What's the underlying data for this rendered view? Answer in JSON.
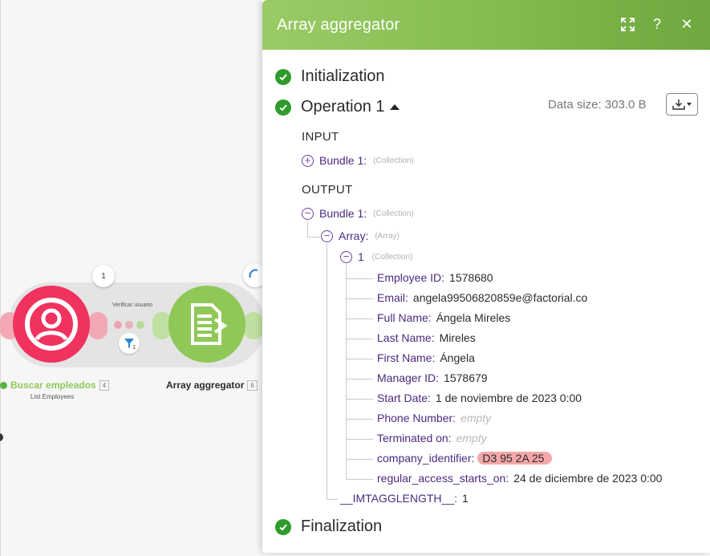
{
  "canvas": {
    "module1": {
      "name": "Buscar empleados",
      "index": "4",
      "subtitle": "List Employees"
    },
    "module2": {
      "name": "Array aggregator",
      "index": "6"
    },
    "filter": {
      "label": "Verificar usuario",
      "count": "1"
    },
    "bubble_count": "1"
  },
  "panel": {
    "title": "Array aggregator",
    "initialization": "Initialization",
    "operation": "Operation 1",
    "finalization": "Finalization",
    "data_size": "Data size: 303.0 B",
    "input_heading": "INPUT",
    "output_heading": "OUTPUT",
    "input_bundle": {
      "key": "Bundle 1:",
      "type": "(Collection)"
    },
    "output_bundle": {
      "key": "Bundle 1:",
      "type": "(Collection)"
    },
    "array": {
      "key": "Array:",
      "type": "(Array)"
    },
    "item": {
      "key": "1",
      "type": "(Collection)"
    },
    "fields": [
      {
        "key": "Employee ID:",
        "value": "1578680"
      },
      {
        "key": "Email:",
        "value": "angela99506820859e@factorial.co"
      },
      {
        "key": "Full Name:",
        "value": "Ángela Mireles"
      },
      {
        "key": "Last Name:",
        "value": "Mireles"
      },
      {
        "key": "First Name:",
        "value": "Ángela"
      },
      {
        "key": "Manager ID:",
        "value": "1578679"
      },
      {
        "key": "Start Date:",
        "value": "1 de noviembre de 2023 0:00"
      },
      {
        "key": "Phone Number:",
        "value": "empty"
      },
      {
        "key": "Terminated on:",
        "value": "empty"
      },
      {
        "key": "company_identifier:",
        "value": "D3 95 2A 25"
      },
      {
        "key": "regular_access_starts_on:",
        "value": "24 de diciembre de 2023 0:00"
      }
    ],
    "length": {
      "key": "__IMTAGGLENGTH__:",
      "value": "1"
    }
  },
  "colors": {
    "header_green": "#8fc857",
    "check_green": "#2f9b2c",
    "key_purple": "#4b2a80",
    "factorial_red": "#f0325f",
    "highlight": "#f4a7a9"
  },
  "icons": [
    "expand-icon",
    "help-icon",
    "close-icon",
    "check-icon",
    "caret-up-icon",
    "download-icon",
    "plus-circle-icon",
    "minus-circle-icon",
    "filter-icon",
    "user-icon",
    "aggregator-icon"
  ]
}
